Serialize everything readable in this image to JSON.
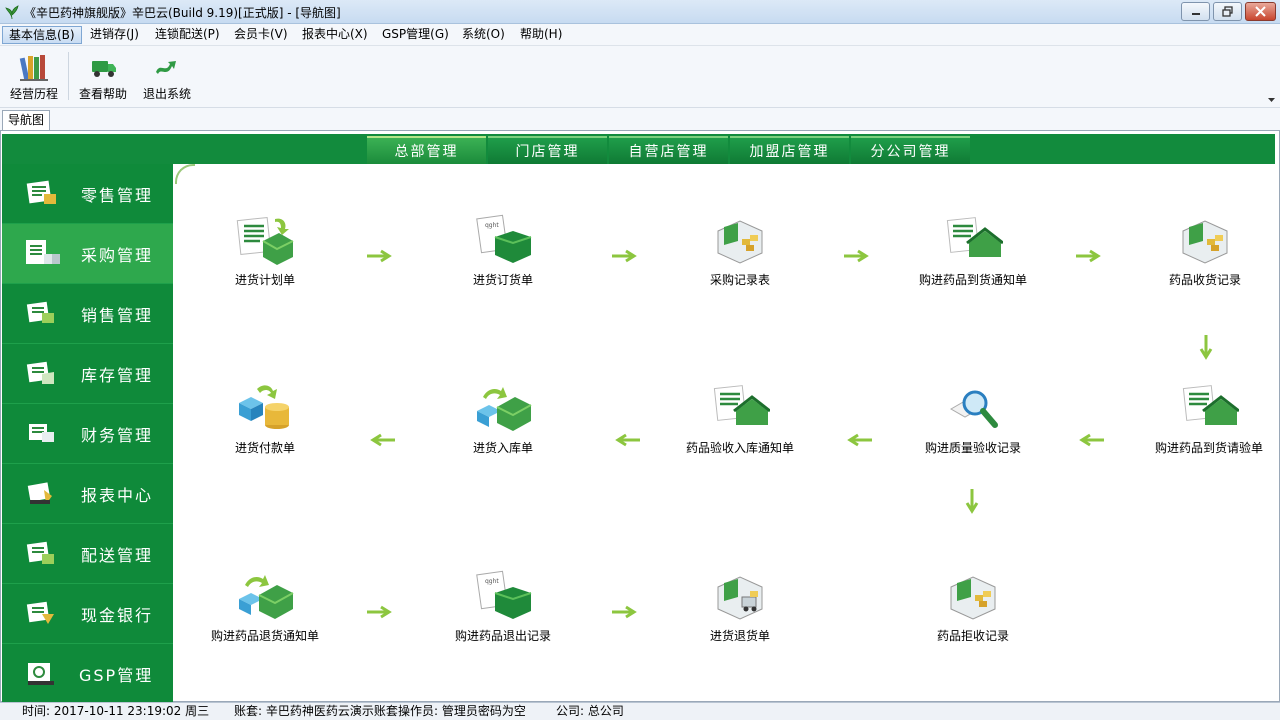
{
  "window": {
    "title": "《辛巴药神旗舰版》辛巴云(Build 9.19)[正式版] - [导航图]",
    "app_icon": "herb-leaf-icon",
    "controls": [
      "minimize-icon",
      "restore-icon",
      "close-icon"
    ]
  },
  "menubar": {
    "items": [
      {
        "label": "基本信息(B)"
      },
      {
        "label": "进销存(J)"
      },
      {
        "label": "连锁配送(P)"
      },
      {
        "label": "会员卡(V)"
      },
      {
        "label": "报表中心(X)"
      },
      {
        "label": "GSP管理(G)"
      },
      {
        "label": "系统(O)"
      },
      {
        "label": "帮助(H)"
      }
    ]
  },
  "toolbar": {
    "items": [
      {
        "label": "经营历程",
        "icon": "books-icon"
      },
      {
        "label": "查看帮助",
        "icon": "truck-icon"
      },
      {
        "label": "退出系统",
        "icon": "exit-arrow-icon"
      }
    ]
  },
  "doc_tab": {
    "label": "导航图"
  },
  "top_tabs": [
    {
      "label": "总部管理"
    },
    {
      "label": "门店管理"
    },
    {
      "label": "自营店管理"
    },
    {
      "label": "加盟店管理"
    },
    {
      "label": "分公司管理"
    }
  ],
  "sidebar": {
    "items": [
      {
        "label": "零售管理",
        "icon": "retail-icon"
      },
      {
        "label": "采购管理",
        "icon": "purchase-icon"
      },
      {
        "label": "销售管理",
        "icon": "sales-icon"
      },
      {
        "label": "库存管理",
        "icon": "inventory-icon"
      },
      {
        "label": "财务管理",
        "icon": "finance-icon"
      },
      {
        "label": "报表中心",
        "icon": "report-icon"
      },
      {
        "label": "配送管理",
        "icon": "delivery-icon"
      },
      {
        "label": "现金银行",
        "icon": "cash-bank-icon"
      },
      {
        "label": "GSP管理",
        "icon": "gsp-icon"
      }
    ]
  },
  "flow": {
    "nodes": [
      {
        "label": "进货计划单",
        "icon": "plan-doc-icon"
      },
      {
        "label": "进货订货单",
        "icon": "order-box-icon"
      },
      {
        "label": "采购记录表",
        "icon": "record-box-icon"
      },
      {
        "label": "购进药品到货通知单",
        "icon": "arrival-notice-icon"
      },
      {
        "label": "药品收货记录",
        "icon": "receipt-record-icon"
      },
      {
        "label": "购进药品到货请验单",
        "icon": "inspection-request-icon"
      },
      {
        "label": "购进质量验收记录",
        "icon": "magnifier-icon"
      },
      {
        "label": "药品验收入库通知单",
        "icon": "storage-notice-icon"
      },
      {
        "label": "进货入库单",
        "icon": "stock-in-icon"
      },
      {
        "label": "进货付款单",
        "icon": "payment-coins-icon"
      },
      {
        "label": "购进药品退货通知单",
        "icon": "return-notice-icon"
      },
      {
        "label": "购进药品退出记录",
        "icon": "return-record-icon"
      },
      {
        "label": "进货退货单",
        "icon": "return-order-icon"
      },
      {
        "label": "药品拒收记录",
        "icon": "rejection-record-icon"
      }
    ]
  },
  "statusbar": {
    "time": "时间: 2017-10-11 23:19:02 周三",
    "account": "账套: 辛巴药神医药云演示账套",
    "operator": "操作员: 管理员密码为空",
    "company": "公司: 总公司"
  },
  "colors": {
    "sidebar_bg": "#0f8a3a",
    "sidebar_active": "#2ea84d",
    "tab_bar": "#128b3d",
    "flow_arrow": "#8cc63f"
  }
}
